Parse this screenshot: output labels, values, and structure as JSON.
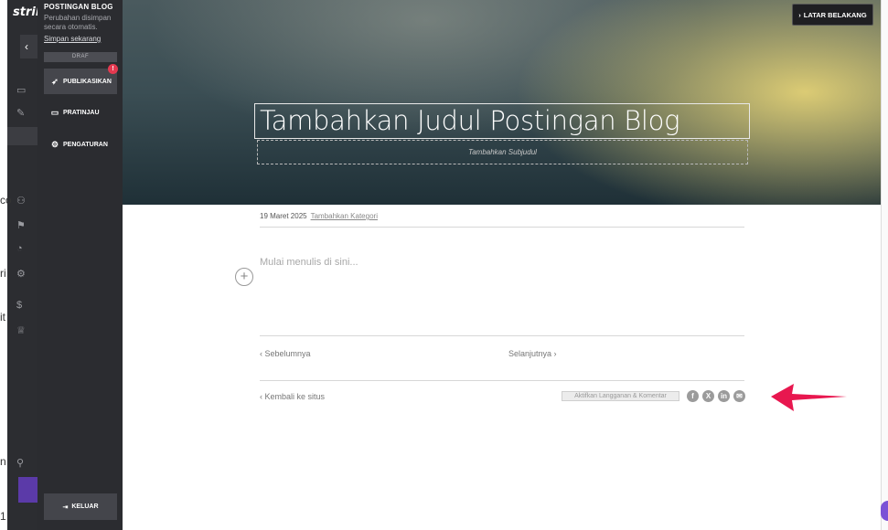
{
  "background_app": {
    "logo": "strik",
    "fragments": [
      "co",
      "ri",
      "it",
      "n",
      "1"
    ]
  },
  "panel": {
    "title": "POSTINGAN BLOG",
    "autosave_note": "Perubahan disimpan secara otomatis.",
    "save_now_link": "Simpan sekarang",
    "status_badge": "DRAF",
    "buttons": [
      {
        "label": "PUBLIKASIKAN",
        "icon": "rocket-icon"
      },
      {
        "label": "PRATINJAU",
        "icon": "monitor-icon"
      },
      {
        "label": "PENGATURAN",
        "icon": "gear-icon"
      }
    ],
    "publish_alert": "!",
    "exit_label": "KELUAR",
    "exit_icon": "exit-icon"
  },
  "hero": {
    "background_button": "LATAR BELAKANG",
    "title": "Tambahkan Judul Postingan Blog",
    "subtitle_placeholder": "Tambahkan Subjudul"
  },
  "post": {
    "date": "19 Maret 2025",
    "category_link": "Tambahkan Kategori",
    "content_placeholder": "Mulai menulis di sini...",
    "prev_label": "Sebelumnya",
    "next_label": "Selanjutnya",
    "back_label": "Kembali ke situs",
    "subscribe_toggle": "Aktifkan Langganan & Komentar",
    "share_icons": [
      "facebook-icon",
      "x-icon",
      "linkedin-icon",
      "email-icon"
    ]
  },
  "colors": {
    "panel_bg": "#2b2c30",
    "badge_red": "#e53950",
    "annotation_arrow": "#e8174f"
  }
}
